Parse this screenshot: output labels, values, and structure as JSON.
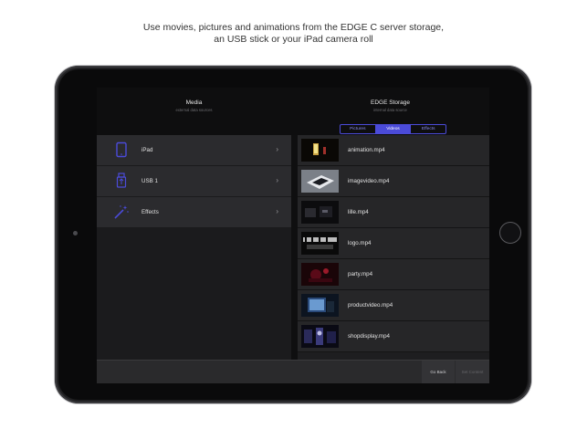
{
  "caption": {
    "line1": "Use movies, pictures and animations from the EDGE C server storage,",
    "line2": "an USB stick or your iPad camera roll"
  },
  "media": {
    "title": "Media",
    "subtitle": "external data sources",
    "items": [
      {
        "label": "iPad",
        "icon": "tablet-icon"
      },
      {
        "label": "USB 1",
        "icon": "usb-icon"
      },
      {
        "label": "Effects",
        "icon": "magic-wand-icon"
      }
    ]
  },
  "storage": {
    "title": "EDGE Storage",
    "subtitle": "internal data source",
    "tabs": [
      "Pictures",
      "Videos",
      "Effects"
    ],
    "active_tab": "Videos",
    "files": [
      {
        "name": "animation.mp4"
      },
      {
        "name": "imagevideo.mp4"
      },
      {
        "name": "lille.mp4"
      },
      {
        "name": "logo.mp4"
      },
      {
        "name": "party.mp4"
      },
      {
        "name": "productvideo.mp4"
      },
      {
        "name": "shopdisplay.mp4"
      }
    ]
  },
  "toolbar": {
    "go_back": "Go Back",
    "set_content": "Set Content"
  },
  "colors": {
    "accent": "#4b4bd9",
    "background": "#1e1e20",
    "device": "#202022"
  }
}
